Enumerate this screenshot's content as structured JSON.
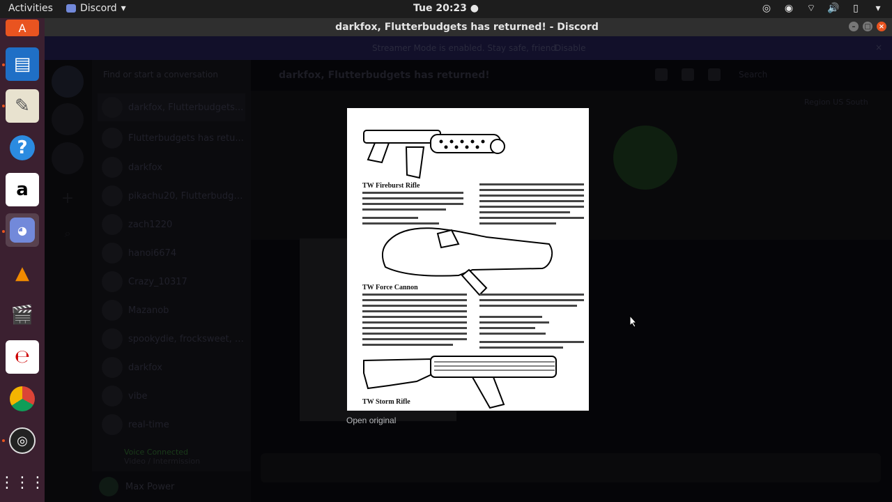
{
  "topbar": {
    "activities": "Activities",
    "app_name": "Discord",
    "clock": "Tue 20:23"
  },
  "window": {
    "title": "darkfox, Flutterbudgets has returned! - Discord"
  },
  "dock": {
    "apps": [
      "ubuntu-software",
      "libreoffice-writer",
      "text-editor",
      "help",
      "amazon",
      "discord",
      "vlc",
      "video-editor",
      "evince",
      "chrome",
      "obs",
      "show-applications"
    ]
  },
  "discord": {
    "banner": {
      "text": "Streamer Mode is enabled. Stay safe, friend.",
      "disable": "Disable"
    },
    "dm_search_placeholder": "Find or start a conversation",
    "dms": [
      "darkfox, Flutterbudgets...",
      "Flutterbudgets has retu...",
      "darkfox",
      "pikachu20, Flutterbudge...",
      "zach1220",
      "hanoi6674",
      "Crazy_10317",
      "Mazanob",
      "spookydie, frocksweet, K...",
      "darkfox",
      "vibe",
      "real-time"
    ],
    "voice": {
      "status": "Voice Connected",
      "channel": "Video / Intermission"
    },
    "user": {
      "name": "Max Power"
    },
    "channel_header": "darkfox, Flutterbudgets has returned!",
    "search_placeholder": "Search",
    "region_label": "Region",
    "region_value": "US South"
  },
  "viewer": {
    "headings": [
      "TW Fireburst Rifle",
      "TW Force Cannon",
      "TW Storm Rifle"
    ],
    "open_original": "Open original"
  }
}
